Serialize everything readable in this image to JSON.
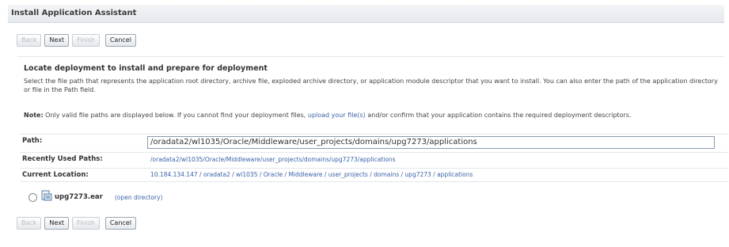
{
  "window": {
    "title": "Install Application Assistant"
  },
  "toolbar": {
    "back": "Back",
    "next": "Next",
    "finish": "Finish",
    "cancel": "Cancel"
  },
  "main": {
    "heading": "Locate deployment to install and prepare for deployment",
    "description": "Select the file path that represents the application root directory, archive file, exploded archive directory, or application module descriptor that you want to install. You can also enter the path of the application directory or file in the Path field.",
    "note_label": "Note:",
    "note_text_1": " Only valid file paths are displayed below. If you cannot find your deployment files, ",
    "note_link": "upload your file(s)",
    "note_text_2": " and/or confirm that your application contains the required deployment descriptors."
  },
  "form": {
    "path_label": "Path:",
    "path_value": "/oradata2/wl1035/Oracle/Middleware/user_projects/domains/upg7273/applications",
    "recent_label": "Recently Used Paths:",
    "recent_value": "/oradata2/wl1035/Oracle/Middleware/user_projects/domains/upg7273/applications",
    "current_label": "Current Location:",
    "current_value": "10.184.134.147 / oradata2 / wl1035 / Oracle / Middleware / user_projects / domains / upg7273 / applications"
  },
  "files": [
    {
      "name": "upg7273.ear",
      "link": "(open directory)",
      "icon": "archive-file-icon"
    }
  ],
  "colors": {
    "link": "#3b63a8",
    "title_bar": "#e6eaee"
  }
}
